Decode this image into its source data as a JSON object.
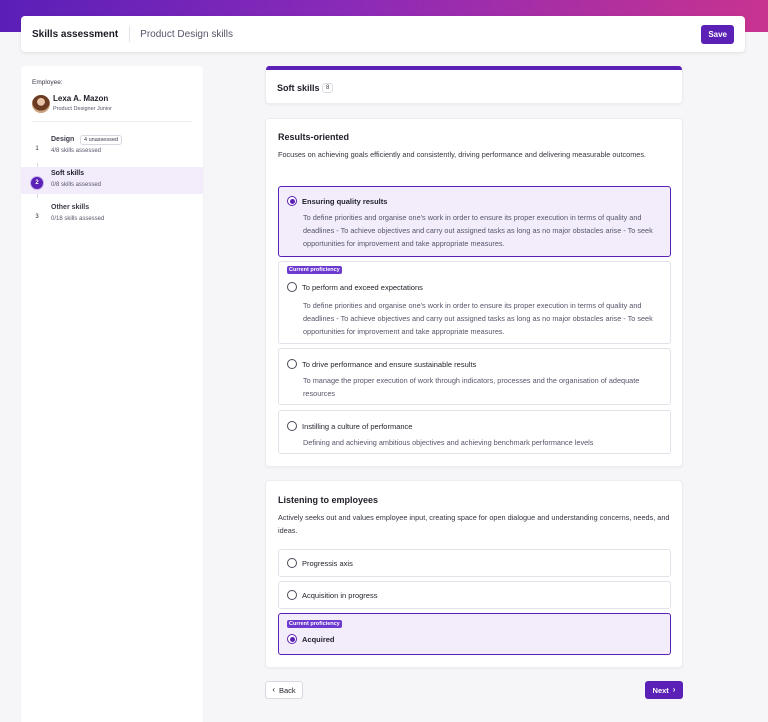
{
  "header": {
    "title": "Skills assessment",
    "subtitle": "Product Design skills",
    "save_label": "Save"
  },
  "sidebar": {
    "employee_label": "Employee:",
    "employee_name": "Lexa A. Mazon",
    "employee_role": "Product Designer Junior",
    "steps": [
      {
        "number": "1",
        "name": "Design",
        "badge": "4 unassessed",
        "count": "4/8 skills assessed"
      },
      {
        "number": "2",
        "name": "Soft skills",
        "count": "0/8 skills assessed"
      },
      {
        "number": "3",
        "name": "Other skills",
        "count": "0/18 skills assessed"
      }
    ]
  },
  "main": {
    "section_title": "Soft skills",
    "section_count": "8",
    "skills": [
      {
        "title": "Results-oriented",
        "description": "Focuses on achieving goals efficiently and consistently, driving performance and delivering measurable outcomes.",
        "options": [
          {
            "label": "Ensuring quality results",
            "description": "To define priorities and organise one's work in order to ensure its proper execution in terms of quality and deadlines - To achieve objectives and carry out assigned tasks as long as no major obstacles arise - To seek opportunities for improvement and take appropriate measures."
          },
          {
            "badge": "Current proficiency",
            "label": "To perform and exceed expectations",
            "description": "To define priorities and organise one's work in order to ensure its proper execution in terms of quality and deadlines - To achieve objectives and carry out assigned tasks as long as no major obstacles arise - To seek opportunities for improvement and take appropriate measures."
          },
          {
            "label": "To drive performance and ensure sustainable results",
            "description": "To manage the proper execution of work through indicators, processes and the organisation of adequate resources"
          },
          {
            "label": "Instilling a culture of performance",
            "description": "Defining and achieving ambitious objectives and achieving benchmark performance levels"
          }
        ]
      },
      {
        "title": "Listening to employees",
        "description": "Actively seeks out and values employee input, creating space for open dialogue and understanding concerns, needs, and ideas.",
        "options": [
          {
            "label": "Progressis axis"
          },
          {
            "label": "Acquisition in progress"
          },
          {
            "badge": "Current proficiency",
            "label": "Acquired"
          }
        ]
      }
    ]
  },
  "footer": {
    "back_label": "Back",
    "next_label": "Next"
  },
  "colors": {
    "accent": "#5b21b6",
    "selected_bg": "#f3edfb",
    "gradient_start": "#5a1fb8",
    "gradient_end": "#c8338f"
  }
}
